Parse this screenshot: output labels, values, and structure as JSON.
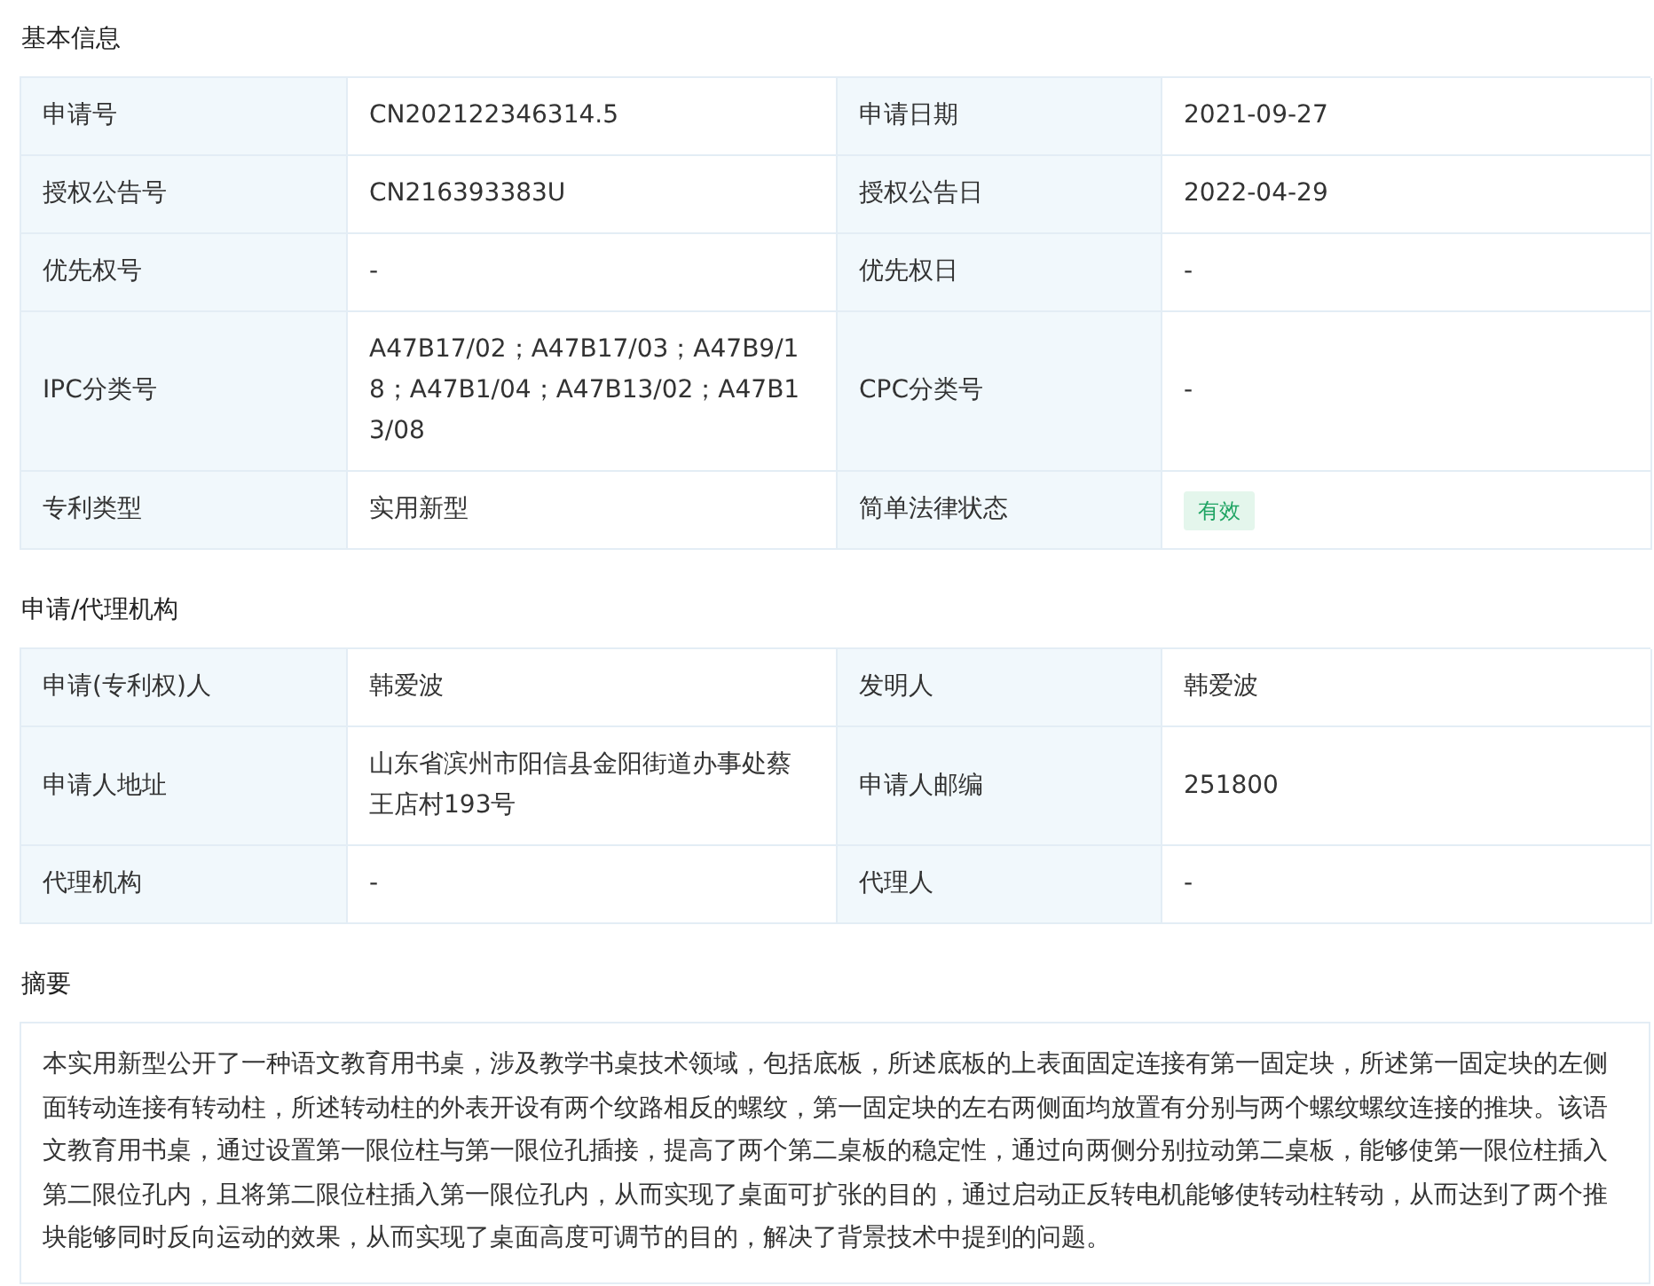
{
  "sections": [
    {
      "title": "基本信息",
      "rows": [
        [
          {
            "label": "申请号",
            "value": "CN202122346314.5",
            "kind": "text"
          },
          {
            "label": "申请日期",
            "value": "2021-09-27",
            "kind": "text"
          }
        ],
        [
          {
            "label": "授权公告号",
            "value": "CN216393383U",
            "kind": "text"
          },
          {
            "label": "授权公告日",
            "value": "2022-04-29",
            "kind": "text"
          }
        ],
        [
          {
            "label": "优先权号",
            "value": "-",
            "kind": "text"
          },
          {
            "label": "优先权日",
            "value": "-",
            "kind": "text"
          }
        ],
        [
          {
            "label": "IPC分类号",
            "value": "A47B17/02；A47B17/03；A47B9/18；A47B1/04；A47B13/02；A47B13/08",
            "kind": "text"
          },
          {
            "label": "CPC分类号",
            "value": "-",
            "kind": "text"
          }
        ],
        [
          {
            "label": "专利类型",
            "value": "实用新型",
            "kind": "text"
          },
          {
            "label": "简单法律状态",
            "value": "有效",
            "kind": "tag"
          }
        ]
      ]
    },
    {
      "title": "申请/代理机构",
      "rows": [
        [
          {
            "label": "申请(专利权)人",
            "value": "韩爱波",
            "kind": "text"
          },
          {
            "label": "发明人",
            "value": "韩爱波",
            "kind": "text"
          }
        ],
        [
          {
            "label": "申请人地址",
            "value": "山东省滨州市阳信县金阳街道办事处蔡王店村193号",
            "kind": "text"
          },
          {
            "label": "申请人邮编",
            "value": "251800",
            "kind": "text"
          }
        ],
        [
          {
            "label": "代理机构",
            "value": "-",
            "kind": "text"
          },
          {
            "label": "代理人",
            "value": "-",
            "kind": "text"
          }
        ]
      ]
    }
  ],
  "abstract": {
    "title": "摘要",
    "text": "本实用新型公开了一种语文教育用书桌，涉及教学书桌技术领域，包括底板，所述底板的上表面固定连接有第一固定块，所述第一固定块的左侧面转动连接有转动柱，所述转动柱的外表开设有两个纹路相反的螺纹，第一固定块的左右两侧面均放置有分别与两个螺纹螺纹连接的推块。该语文教育用书桌，通过设置第一限位柱与第一限位孔插接，提高了两个第二桌板的稳定性，通过向两侧分别拉动第二桌板，能够使第一限位柱插入第二限位孔内，且将第二限位柱插入第一限位孔内，从而实现了桌面可扩张的目的，通过启动正反转电机能够使转动柱转动，从而达到了两个推块能够同时反向运动的效果，从而实现了桌面高度可调节的目的，解决了背景技术中提到的问题。"
  }
}
